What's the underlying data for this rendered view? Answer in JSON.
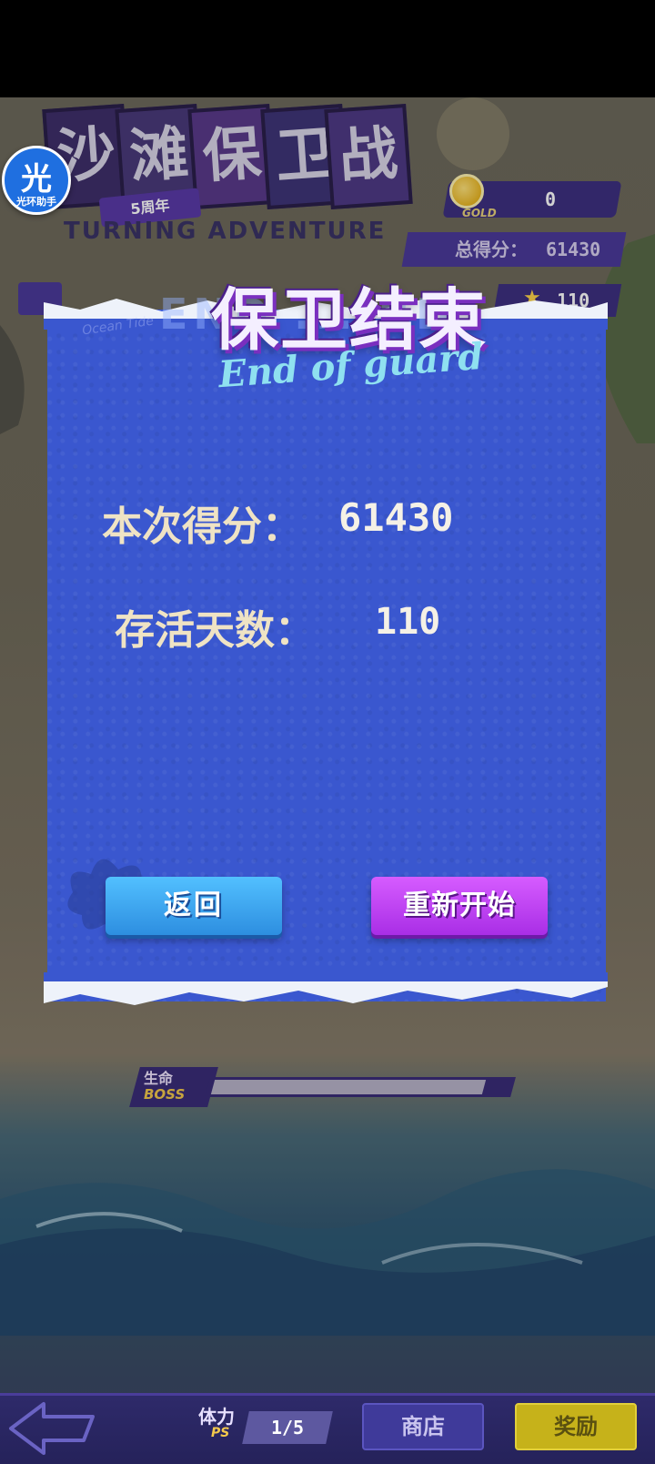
{
  "game": {
    "title_chars": [
      "沙",
      "滩",
      "保",
      "卫",
      "战"
    ],
    "anniversary_badge": "5周年",
    "subtitle_en": "TURNING ADVENTURE",
    "gold_tag": "GOLD",
    "gold_value": "0",
    "total_score_label": "总得分：",
    "total_score_value": "61430",
    "day_value": "110",
    "boss": {
      "life_label": "生命",
      "tag": "BOSS",
      "health_fraction": 0.92
    }
  },
  "helper": {
    "glyph": "光",
    "label": "光环助手"
  },
  "dialog": {
    "title": "保卫结束",
    "title_en": "END ... RD",
    "script_text": "End of guard",
    "score_label": "本次得分：",
    "score_value": "61430",
    "days_label": "存活天数：",
    "days_value": "110",
    "return_button": "返回",
    "restart_button": "重新开始"
  },
  "bottom_bar": {
    "stamina_label": "体力",
    "stamina_ps": "PS",
    "stamina_value": "1/5",
    "shop_button": "商店",
    "reward_button": "奖励"
  },
  "colors": {
    "dialog_bg": "#3a57cf",
    "return_button": "#2d8ee0",
    "restart_button": "#a92ee6",
    "reward_button": "#c6b21a"
  },
  "icons": [
    "back-arrow-icon",
    "gold-coin-icon",
    "star-icon",
    "helper-logo-icon",
    "splash-icon"
  ]
}
